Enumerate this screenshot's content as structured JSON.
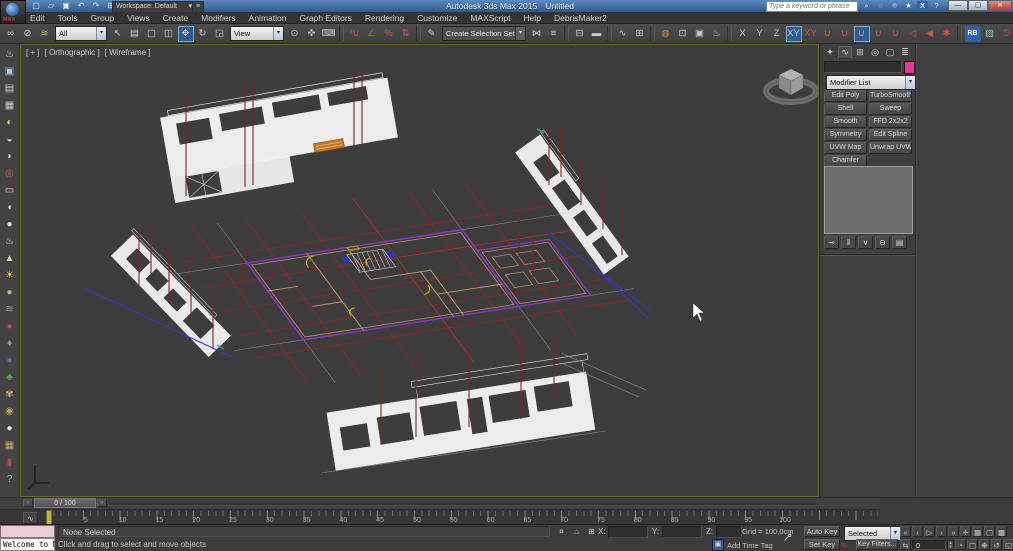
{
  "window": {
    "title_app": "Autodesk 3ds Max 2015",
    "title_doc": "Untitled",
    "workspace_label": "Workspace: Default",
    "workspace_caret": "▾",
    "search_placeholder": "Type a keyword or phrase",
    "min_glyph": "—",
    "max_glyph": "▢",
    "close_glyph": "✕",
    "app_logo_text": "MAX",
    "qat_icons": [
      {
        "name": "new-scene-icon",
        "glyph": "▢"
      },
      {
        "name": "open-file-icon",
        "glyph": "▱"
      },
      {
        "name": "save-file-icon",
        "glyph": "▣"
      },
      {
        "name": "undo-icon",
        "glyph": "↶"
      },
      {
        "name": "redo-icon",
        "glyph": "↷"
      },
      {
        "name": "project-folder-icon",
        "glyph": "⊞"
      }
    ],
    "infocenter_icons": [
      {
        "name": "infocenter-search-icon",
        "glyph": "⌕"
      },
      {
        "name": "sign-in-icon",
        "glyph": "◌"
      },
      {
        "name": "communication-center-icon",
        "glyph": "⌾"
      },
      {
        "name": "favorites-star-icon",
        "glyph": "★"
      },
      {
        "name": "exchange-apps-icon",
        "glyph": "X",
        "cls": "blue"
      },
      {
        "name": "help-icon",
        "glyph": "?"
      }
    ]
  },
  "menu": {
    "items": [
      "Edit",
      "Tools",
      "Group",
      "Views",
      "Create",
      "Modifiers",
      "Animation",
      "Graph Editors",
      "Rendering",
      "Customize",
      "MAXScript",
      "Help",
      "DebrisMaker2"
    ]
  },
  "toolbar": {
    "selection_filter": "All",
    "ref_coord": "View",
    "named_sets": "Create Selection Set",
    "groupA": [
      {
        "name": "select-and-link-icon",
        "glyph": "∞"
      },
      {
        "name": "unlink-selection-icon",
        "glyph": "⊘"
      },
      {
        "name": "bind-to-space-warp-icon",
        "glyph": "≋",
        "color": "#d4b83c"
      }
    ],
    "groupB": [
      {
        "name": "select-object-icon",
        "glyph": "↖"
      },
      {
        "name": "select-by-name-icon",
        "glyph": "▤"
      },
      {
        "name": "rectangular-selection-region-icon",
        "glyph": "▢"
      },
      {
        "name": "window-crossing-icon",
        "glyph": "◫"
      },
      {
        "name": "select-and-move-icon",
        "glyph": "✥",
        "cls": "active"
      },
      {
        "name": "select-and-rotate-icon",
        "glyph": "↻"
      },
      {
        "name": "select-and-scale-icon",
        "glyph": "◲"
      }
    ],
    "groupC": [
      {
        "name": "use-pivot-point-center-icon",
        "glyph": "⊙"
      },
      {
        "name": "select-and-manipulate-icon",
        "glyph": "✜"
      },
      {
        "name": "keyboard-shortcut-override-icon",
        "glyph": "⌨"
      },
      {
        "name": "separator",
        "glyph": "",
        "cls": "sep"
      },
      {
        "name": "snaps-toggle-3d-icon",
        "glyph": "³∪",
        "color": "#cc5544"
      },
      {
        "name": "angle-snap-icon",
        "glyph": "∠",
        "color": "#cc5544"
      },
      {
        "name": "percent-snap-icon",
        "glyph": "%",
        "color": "#cc5544"
      },
      {
        "name": "spinner-snap-icon",
        "glyph": "⇅",
        "color": "#cc5544"
      },
      {
        "name": "separator",
        "glyph": "",
        "cls": "sep"
      },
      {
        "name": "edit-named-selection-sets-icon",
        "glyph": "✎"
      }
    ],
    "groupD": [
      {
        "name": "mirror-icon",
        "glyph": "⋈"
      },
      {
        "name": "align-icon",
        "glyph": "≡"
      },
      {
        "name": "separator",
        "glyph": "",
        "cls": "sep"
      },
      {
        "name": "manage-layers-icon",
        "glyph": "⊟"
      },
      {
        "name": "graphite-ribbon-toggle-icon",
        "glyph": "▬"
      },
      {
        "name": "separator",
        "glyph": "",
        "cls": "sep"
      },
      {
        "name": "curve-editor-icon",
        "glyph": "∿"
      },
      {
        "name": "schematic-view-icon",
        "glyph": "⊞"
      },
      {
        "name": "separator",
        "glyph": "",
        "cls": "sep"
      },
      {
        "name": "material-editor-icon",
        "glyph": "◍",
        "color": "#cc8840"
      },
      {
        "name": "render-setup-icon",
        "glyph": "⊡"
      },
      {
        "name": "rendered-frame-window-icon",
        "glyph": "▣"
      },
      {
        "name": "render-production-icon",
        "glyph": "♨"
      },
      {
        "name": "separator",
        "glyph": "",
        "cls": "sep"
      }
    ],
    "axis": [
      {
        "name": "constrain-x-button",
        "glyph": "X"
      },
      {
        "name": "constrain-y-button",
        "glyph": "Y"
      },
      {
        "name": "constrain-z-button",
        "glyph": "Z"
      },
      {
        "name": "constrain-xy-plane-button",
        "glyph": "XY",
        "cls": "active"
      },
      {
        "name": "snaps-use-axis-constraints-icon",
        "glyph": "XY",
        "color": "#cc5544"
      }
    ],
    "snaps": [
      {
        "name": "snap-grid-points-icon",
        "glyph": "∪",
        "color": "#cc5544"
      },
      {
        "name": "snap-pivot-icon",
        "glyph": "∪",
        "color": "#cc5544"
      },
      {
        "name": "snap-vertex-icon",
        "glyph": "∪",
        "cls": "active",
        "color": "#ff8877"
      },
      {
        "name": "snap-endpoint-icon",
        "glyph": "∪",
        "color": "#cc5544"
      },
      {
        "name": "snap-midpoint-icon",
        "glyph": "∪",
        "color": "#cc5544"
      },
      {
        "name": "snap-edge-icon",
        "glyph": "◁",
        "color": "#cc5544"
      },
      {
        "name": "snap-face-icon",
        "glyph": "◀",
        "color": "#cc5544"
      },
      {
        "name": "snap-frozen-icon",
        "glyph": "✱",
        "color": "#cc5544"
      }
    ],
    "plugins": [
      {
        "name": "separator",
        "glyph": "",
        "cls": "sep"
      },
      {
        "name": "railclone-icon",
        "glyph": "RB",
        "cls": "blue"
      },
      {
        "name": "forestpack-icon",
        "glyph": "▨",
        "color": "#9ab0c8"
      },
      {
        "name": "debrismaker-icon",
        "glyph": "Ɔ",
        "color": "#cc4433"
      },
      {
        "name": "checker-pattern-icon",
        "glyph": "▩",
        "color": "#bbb"
      },
      {
        "name": "vray-icon",
        "glyph": "▼",
        "color": "#cc2222"
      },
      {
        "name": "plugin-sphere-icon",
        "glyph": "◉",
        "color": "#999999"
      }
    ]
  },
  "left_toolbar": {
    "items": [
      {
        "name": "render-teapot-icon",
        "glyph": "♨",
        "color": "#cfcfcf"
      },
      {
        "name": "rendered-frame-icon",
        "glyph": "▣",
        "color": "#b0c4de"
      },
      {
        "name": "render-setup-icon",
        "glyph": "▤",
        "color": "#cfcfcf"
      },
      {
        "name": "table-grid-icon",
        "glyph": "▦",
        "color": "#cfcfcf"
      },
      {
        "name": "light-icon",
        "glyph": "◐",
        "color": "#e8d060"
      },
      {
        "name": "spotlight-icon",
        "glyph": "◒",
        "color": "#d0d0d0"
      },
      {
        "name": "dome-light-icon",
        "glyph": "◗",
        "color": "#d0d0d0"
      },
      {
        "name": "target-tool-icon",
        "glyph": "◎",
        "color": "#cc5555"
      },
      {
        "name": "box-primitive-icon",
        "glyph": "▭",
        "color": "#e0d8b0"
      },
      {
        "name": "dome-primitive-icon",
        "glyph": "◖",
        "color": "#e8e0c0"
      },
      {
        "name": "sphere-primitive-icon",
        "glyph": "●",
        "color": "#eae2c0"
      },
      {
        "name": "teapot-primitive-icon",
        "glyph": "♨",
        "color": "#e6ddb8"
      },
      {
        "name": "cone-primitive-icon",
        "glyph": "▲",
        "color": "#ddd5b0"
      },
      {
        "name": "sunlight-icon",
        "glyph": "☀",
        "color": "#e8c832"
      },
      {
        "name": "geosphere-icon",
        "glyph": "●",
        "color": "#b8b878"
      },
      {
        "name": "ripple-icon",
        "glyph": "≋",
        "color": "#9a9a9a"
      },
      {
        "name": "red-sphere-icon",
        "glyph": "●",
        "color": "#cc4444"
      },
      {
        "name": "scatter-icon",
        "glyph": "♦",
        "color": "#8899bb"
      },
      {
        "name": "rock-icon",
        "glyph": "●",
        "color": "#5577aa"
      },
      {
        "name": "foliage-icon",
        "glyph": "♣",
        "color": "#55aa55"
      },
      {
        "name": "creature-icon",
        "glyph": "✾",
        "color": "#c8a878"
      },
      {
        "name": "shell-icon",
        "glyph": "◉",
        "color": "#c0a070"
      },
      {
        "name": "marble-sphere-icon",
        "glyph": "●",
        "color": "#dde8f0"
      },
      {
        "name": "building-blocks-icon",
        "glyph": "▦",
        "color": "#c8b050"
      },
      {
        "name": "door-icon",
        "glyph": "▮",
        "color": "#a05050"
      },
      {
        "name": "help-circle-icon",
        "glyph": "?",
        "color": "#aaaaaa"
      }
    ]
  },
  "viewport": {
    "label_plus": "[ + ]",
    "label_view": "[ Orthographic ]",
    "label_shading": "[ Wireframe ]"
  },
  "command_panel": {
    "tabs": [
      {
        "name": "create-tab",
        "glyph": "✦"
      },
      {
        "name": "modify-tab",
        "glyph": "∿",
        "cls": "active"
      },
      {
        "name": "hierarchy-tab",
        "glyph": "⊞"
      },
      {
        "name": "motion-tab",
        "glyph": "◎"
      },
      {
        "name": "display-tab",
        "glyph": "▢"
      },
      {
        "name": "utilities-tab",
        "glyph": "≣"
      }
    ],
    "object_color": "#e03a96",
    "modifier_list_label": "Modifier List",
    "modifier_buttons": [
      "Edit Poly",
      "TurboSmooth",
      "Shell",
      "Sweep",
      "Smooth",
      "FFD 2x2x2",
      "Symmetry",
      "Edit Spline",
      "UVW Map",
      "Unwrap UVW",
      "Chamfer"
    ],
    "stack_buttons": [
      {
        "name": "pin-stack-button",
        "glyph": "⊸"
      },
      {
        "name": "show-end-result-button",
        "glyph": "‖"
      },
      {
        "name": "make-unique-button",
        "glyph": "∨"
      },
      {
        "name": "remove-modifier-button",
        "glyph": "⊝"
      },
      {
        "name": "configure-modifier-sets-button",
        "glyph": "▤"
      }
    ]
  },
  "timeline": {
    "slider_value": "0 / 100",
    "prev_glyph": "‹",
    "next_glyph": "›",
    "mini_curve_glyph": "∿",
    "tick_labels": [
      "5",
      "10",
      "15",
      "20",
      "25",
      "30",
      "35",
      "40",
      "45",
      "50",
      "55",
      "60",
      "65",
      "70",
      "75",
      "80",
      "85",
      "90",
      "95",
      "100"
    ]
  },
  "status_bar": {
    "listener_text": "Welcome to M",
    "selection_status": "None Selected",
    "prompt": "Click and drag to select and move objects",
    "mid_icons": [
      {
        "name": "status-pin-icon",
        "glyph": "¤"
      },
      {
        "name": "selection-lock-icon",
        "glyph": "⌂"
      },
      {
        "name": "absolute-mode-icon",
        "glyph": "⊞"
      }
    ],
    "x_label": "X:",
    "y_label": "Y:",
    "z_label": "Z:",
    "grid_label": "Grid = 100,0cm",
    "add_time_tag": "Add Time Tag",
    "set_keys_glyph": "⊸",
    "auto_key": "Auto Key",
    "set_key": "Set Key",
    "key_filters": "Key Filters...",
    "selected_dropdown": "Selected",
    "key_curve_glyph": "∿",
    "frame_value": "0",
    "transport1": [
      {
        "name": "go-to-start-button",
        "glyph": "«"
      },
      {
        "name": "previous-frame-button",
        "glyph": "‹"
      },
      {
        "name": "play-button",
        "glyph": "▷"
      },
      {
        "name": "next-frame-button",
        "glyph": "›"
      },
      {
        "name": "go-to-end-button",
        "glyph": "»"
      },
      {
        "name": "zoom-icon",
        "glyph": "✛"
      },
      {
        "name": "zoom-all-icon",
        "glyph": "▦"
      },
      {
        "name": "zoom-extents-icon",
        "glyph": "▢"
      },
      {
        "name": "zoom-extents-all-icon",
        "glyph": "▩"
      }
    ],
    "key_mode_glyph": "⇆",
    "transport2": [
      {
        "name": "time-configuration-icon",
        "glyph": "◔"
      },
      {
        "name": "crossing-region-icon",
        "glyph": "▢"
      },
      {
        "name": "pan-view-icon",
        "glyph": "✥"
      },
      {
        "name": "orbit-icon",
        "glyph": "↺"
      },
      {
        "name": "maximize-viewport-toggle-icon",
        "glyph": "◱"
      }
    ]
  },
  "colors": {
    "accent_blue": "#2d5d8e",
    "viewport_bg": "#3d3d3d",
    "wireframe_white": "#e2e2e2",
    "grid_red": "#8b2626",
    "wall_purple": "#8a35c8",
    "wall_tan": "#c49a6a",
    "detail_yellow": "#c8b400",
    "line_blue": "#3435c8"
  }
}
